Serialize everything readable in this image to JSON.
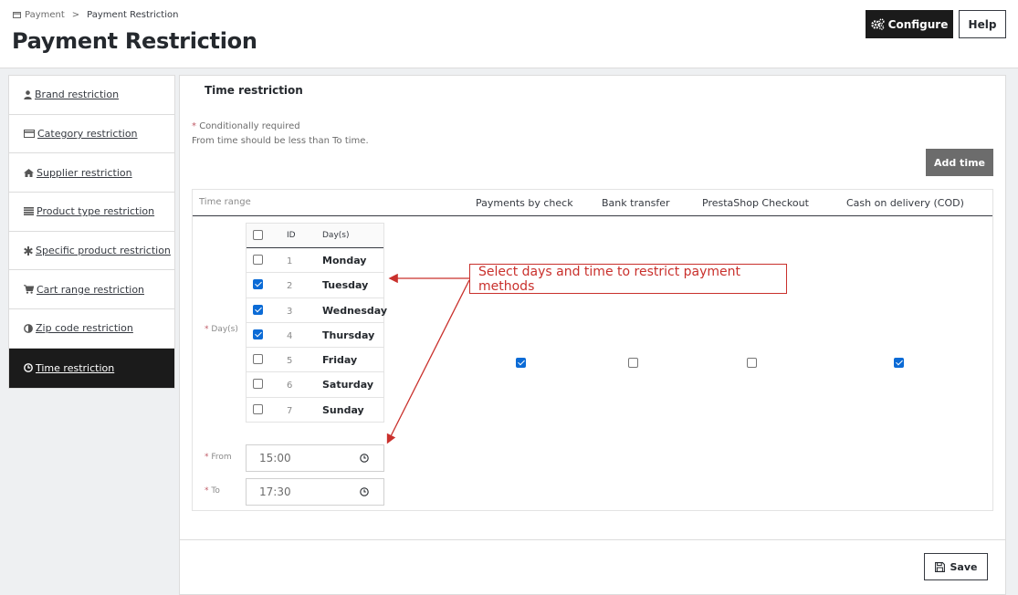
{
  "breadcrumb": {
    "parent": "Payment",
    "separator": ">",
    "current": "Payment Restriction"
  },
  "page_title": "Payment Restriction",
  "toolbar": {
    "configure_label": "Configure",
    "help_label": "Help"
  },
  "sidebar": {
    "items": [
      {
        "label": "Brand restriction",
        "icon": "user-icon"
      },
      {
        "label": "Category restriction",
        "icon": "credit-card-icon"
      },
      {
        "label": "Supplier restriction",
        "icon": "home-icon"
      },
      {
        "label": "Product type restriction",
        "icon": "list-icon"
      },
      {
        "label": "Specific product restriction",
        "icon": "asterisk-icon"
      },
      {
        "label": "Cart range restriction",
        "icon": "cart-icon"
      },
      {
        "label": "Zip code restriction",
        "icon": "adjust-icon"
      },
      {
        "label": "Time restriction",
        "icon": "clock-icon",
        "active": true
      }
    ]
  },
  "panel": {
    "title": "Time restriction",
    "required_mark": "*",
    "conditionally_required": "Conditionally required",
    "note": "From time should be less than To time.",
    "add_time_label": "Add time"
  },
  "table": {
    "headers": [
      "Time range",
      "Payments by check",
      "Bank transfer",
      "PrestaShop Checkout",
      "Cash on delivery (COD)"
    ],
    "methods_checked": [
      true,
      false,
      false,
      true
    ]
  },
  "days": {
    "label": "Day(s)",
    "header_id": "ID",
    "header_day": "Day(s)",
    "rows": [
      {
        "id": "1",
        "name": "Monday",
        "checked": false
      },
      {
        "id": "2",
        "name": "Tuesday",
        "checked": true
      },
      {
        "id": "3",
        "name": "Wednesday",
        "checked": true
      },
      {
        "id": "4",
        "name": "Thursday",
        "checked": true
      },
      {
        "id": "5",
        "name": "Friday",
        "checked": false
      },
      {
        "id": "6",
        "name": "Saturday",
        "checked": false
      },
      {
        "id": "7",
        "name": "Sunday",
        "checked": false
      }
    ]
  },
  "time": {
    "from_label": "From",
    "from_value": "15:00",
    "to_label": "To",
    "to_value": "17:30"
  },
  "save_label": "Save",
  "callout": {
    "text": "Select days and time to restrict payment methods"
  },
  "colors": {
    "accent_dark": "#1b1b1b",
    "checkbox_blue": "#0b6bd6",
    "callout_red": "#c9302c",
    "add_button_gray": "#6c6c6c"
  }
}
